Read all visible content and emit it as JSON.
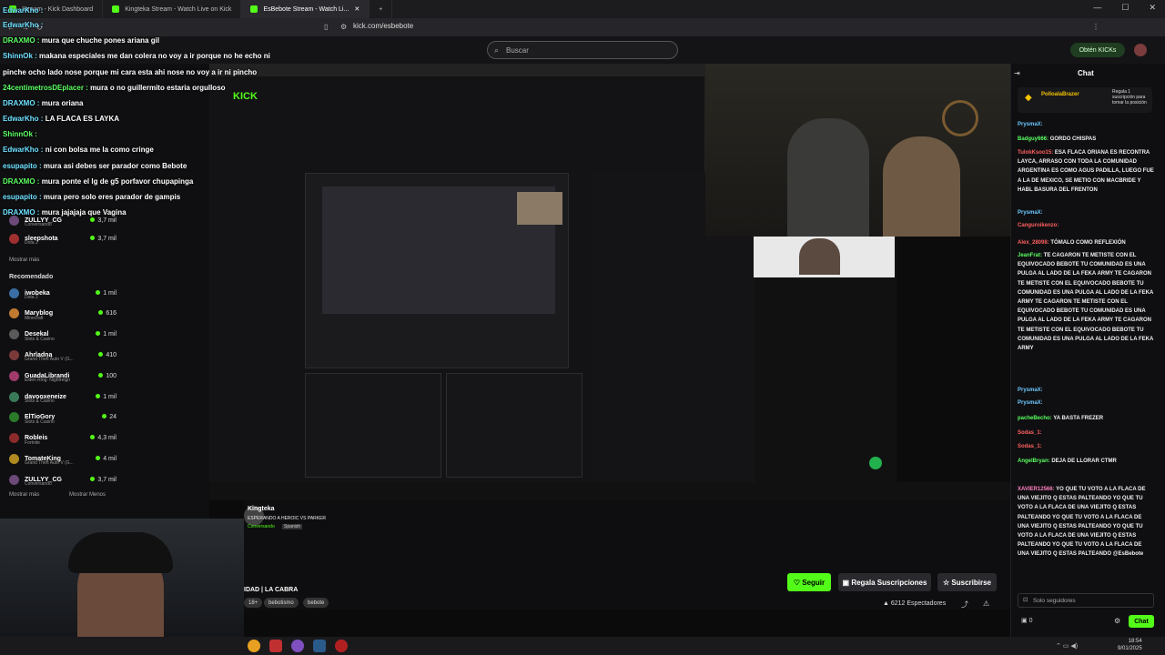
{
  "browser": {
    "tabs": [
      {
        "label": "Stream - Kick Dashboard"
      },
      {
        "label": "Kingteka Stream - Watch Live on Kick"
      },
      {
        "label": "EsBebote Stream - Watch Li..."
      }
    ],
    "url": "kick.com/esbebote"
  },
  "header": {
    "search_placeholder": "Buscar",
    "obten_kicks": "Obtén KICKs"
  },
  "overlay_chat": [
    {
      "user": "EdwarKho :",
      "text": ""
    },
    {
      "user": "EdwarKho :",
      "text": ""
    },
    {
      "user": "DRAXMO :",
      "text": "mura que chuche pones ariana gil"
    },
    {
      "user": "ShinnOk :",
      "text": "makana especiales me dan colera no voy a ir porque no he echo ni"
    },
    {
      "user": "",
      "text": "pinche ocho lado nose porque mi cara esta ahi nose no voy a ir ni pincho"
    },
    {
      "user": "24centimetrosDEplacer :",
      "text": "mura o no guillermito estaria orgulloso"
    },
    {
      "user": "DRAXMO :",
      "text": "mura oriana"
    },
    {
      "user": "EdwarKho :",
      "text": "LA FLACA ES LAYKA"
    },
    {
      "user": "ShinnOk :",
      "text": ""
    },
    {
      "user": "EdwarKho :",
      "text": "ni con bolsa me la como cringe"
    },
    {
      "user": "esupapito :",
      "text": "mura asi debes ser parador como Bebote"
    },
    {
      "user": "DRAXMO :",
      "text": "mura ponte el lg de g5 porfavor chupapinga"
    },
    {
      "user": "esupapito :",
      "text": "mura pero solo eres parador de gampis"
    },
    {
      "user": "DRAXMO :",
      "text": "mura jajajaja que Vagina"
    }
  ],
  "sidebar": {
    "top": [
      {
        "name": "ZULLYY_CG",
        "sub": "Conversando",
        "viewers": "3,7 mil"
      },
      {
        "name": "sleepshota",
        "sub": "Dota 2",
        "viewers": "3,7 mil"
      }
    ],
    "show_more": "Mostrar más",
    "recommended_title": "Recomendado",
    "recommended": [
      {
        "name": "iwobeka",
        "sub": "Dota 2",
        "viewers": "1 mil"
      },
      {
        "name": "Maryblog",
        "sub": "Minecraft",
        "viewers": "616"
      },
      {
        "name": "Desekal",
        "sub": "Slots & Casino",
        "viewers": "1 mil"
      },
      {
        "name": "Ahrladna",
        "sub": "Grand Theft Auto V (G...",
        "viewers": "410"
      },
      {
        "name": "GuadaLibrandi",
        "sub": "Elden Ring: Nightreign",
        "viewers": "100"
      },
      {
        "name": "davooxeneize",
        "sub": "Slots & Casino",
        "viewers": "1 mil"
      },
      {
        "name": "ElTioGory",
        "sub": "Slots & Casino",
        "viewers": "24"
      },
      {
        "name": "Robleis",
        "sub": "Fortnite",
        "viewers": "4,3 mil"
      },
      {
        "name": "TomateKing",
        "sub": "Grand Theft Auto V (G...",
        "viewers": "4 mil"
      },
      {
        "name": "ZULLYY_CG",
        "sub": "Conversando",
        "viewers": "3,7 mil"
      }
    ],
    "show_more_2": "Mostrar más",
    "show_less": "Mostrar Menos"
  },
  "streamer": {
    "name": "Kingteka",
    "subtitle": "ESPERANDO A HEROIC VS PARKER",
    "category": "Conversando",
    "lang": "Spanish",
    "title": "IDAD | LA CABRA",
    "tags": [
      "18+",
      "bebotismo",
      "bebote"
    ],
    "follow": "Seguir",
    "gift": "Regala Suscripciones",
    "subscribe": "Suscribirse",
    "viewers": "6212 Espectadores"
  },
  "right_chat": {
    "title": "Chat",
    "pinned_user": "PolloalaBrazer",
    "pinned_text": "Regala 1 suscripción para tomar la posición",
    "messages": [
      {
        "user": "PrysmaX:",
        "text": "",
        "c": "b"
      },
      {
        "user": "Badguy666:",
        "text": "GORDO CHISPAS",
        "c": "g"
      },
      {
        "user": "TulokKsoo15:",
        "text": "ESA FLACA ORIANA ES RECONTRA LAYCA, ARRASO CON TODA LA COMUNIDAD ARGENTINA ES COMO AGUS PADILLA, LUEGO FUE A LA DE MEXICO, SE METIO CON MACBRIDE Y HABL BASURA DEL FRENTON",
        "c": "r"
      },
      {
        "user": "PrysmaX:",
        "text": "",
        "c": "b"
      },
      {
        "user": "Canguroikenzo:",
        "text": "",
        "c": "r"
      },
      {
        "user": "Alex_28098:",
        "text": "TÓMALO COMO REFLEXIÓN",
        "c": "r"
      },
      {
        "user": "JeanFrat:",
        "text": "TE CAGARON TE METISTE CON EL EQUIVOCADO BEBOTE TU COMUNIDAD ES UNA PULGA AL LADO DE LA FEKA ARMY TE CAGARON TE METISTE CON EL EQUIVOCADO BEBOTE TU COMUNIDAD ES UNA PULGA AL LADO DE LA FEKA ARMY TE CAGARON TE METISTE CON EL EQUIVOCADO BEBOTE TU COMUNIDAD ES UNA PULGA AL LADO DE LA FEKA ARMY TE CAGARON TE METISTE CON EL EQUIVOCADO BEBOTE TU COMUNIDAD ES UNA PULGA AL LADO DE LA FEKA ARMY",
        "c": "g"
      },
      {
        "user": "PrysmaX:",
        "text": "",
        "c": "b"
      },
      {
        "user": "PrysmaX:",
        "text": "",
        "c": "b"
      },
      {
        "user": "pacheBecho:",
        "text": "YA BASTA FREZER",
        "c": "g"
      },
      {
        "user": "Sodas_1:",
        "text": "",
        "c": "r"
      },
      {
        "user": "Sodas_1:",
        "text": "",
        "c": "r"
      },
      {
        "user": "AngelBryan:",
        "text": "DEJA DE LLORAR CTMR",
        "c": "g"
      },
      {
        "user": "XAVIER12566:",
        "text": "YO QUE TU VOTO A LA FLACA DE UNA VIEJITO Q ESTAS PALTEANDO YO QUE TU VOTO A LA FLACA DE UNA VIEJITO Q ESTAS PALTEANDO YO QUE TU VOTO A LA FLACA DE UNA VIEJITO Q ESTAS PALTEANDO YO QUE TU VOTO A LA FLACA DE UNA VIEJITO Q ESTAS PALTEANDO YO QUE TU VOTO A LA FLACA DE UNA VIEJITO Q ESTAS PALTEANDO @EsBebote",
        "c": "p"
      }
    ],
    "solo_seguidores": "Solo seguidores",
    "chat_button": "Chat",
    "count": "0"
  },
  "taskbar": {
    "time": "18:54",
    "date": "9/01/2025"
  }
}
